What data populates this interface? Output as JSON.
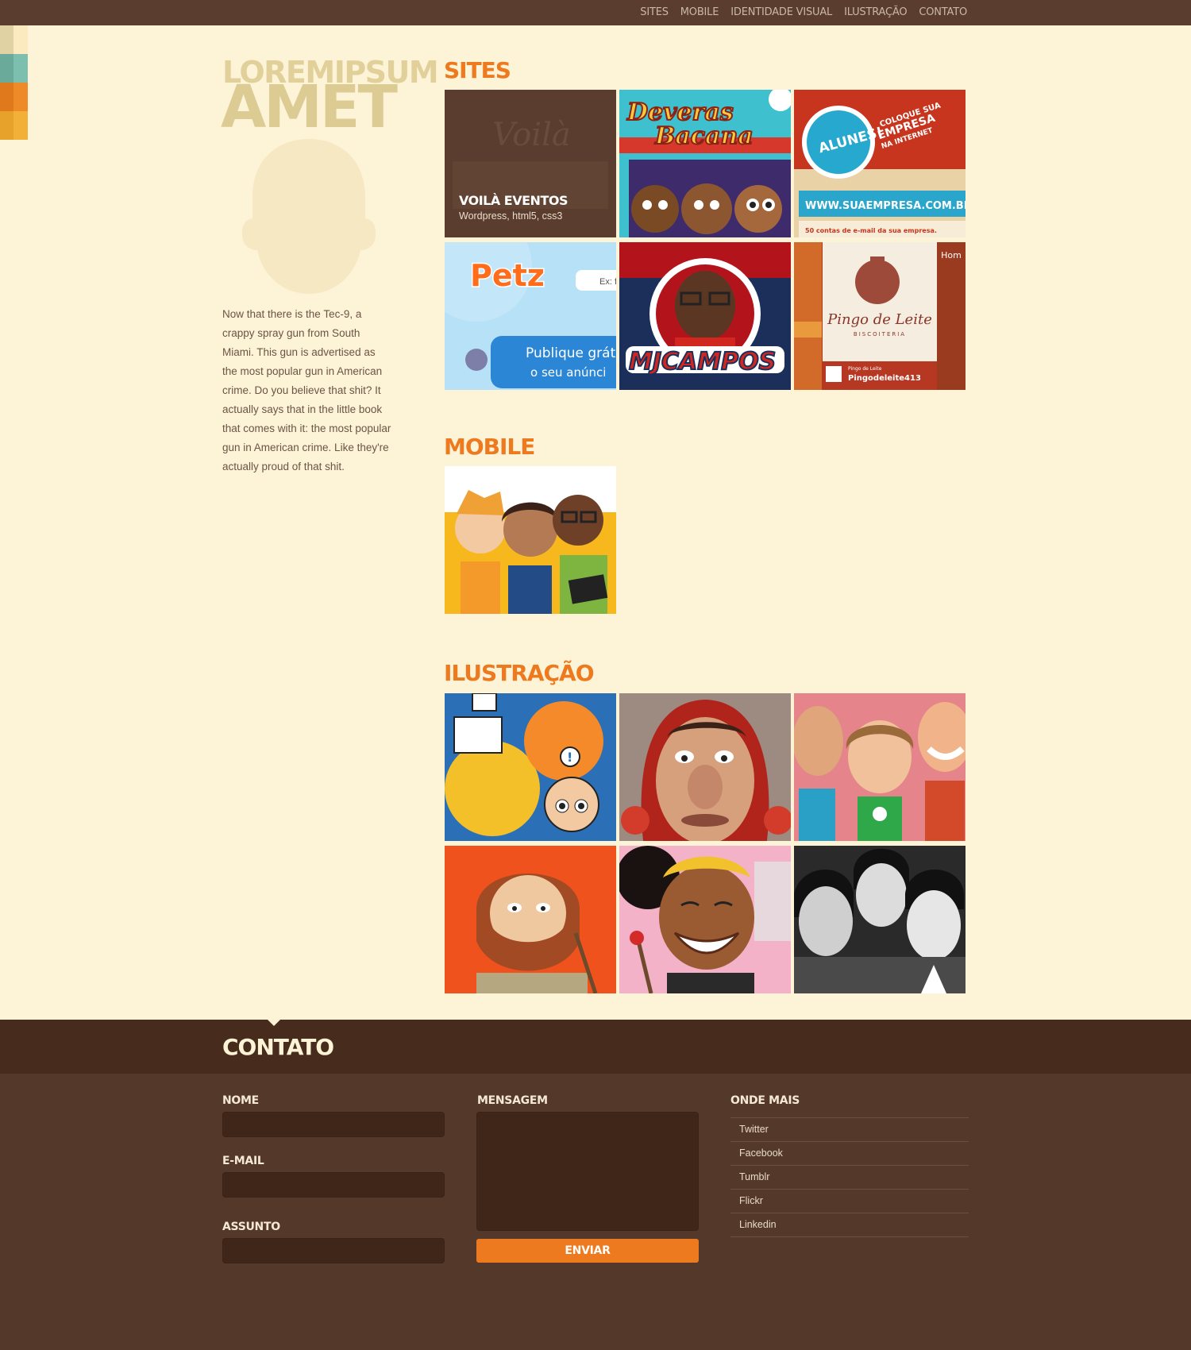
{
  "nav": {
    "items": [
      {
        "label": "SITES"
      },
      {
        "label": "MOBILE"
      },
      {
        "label": "IDENTIDADE VISUAL"
      },
      {
        "label": "ILUSTRAÇÃO"
      },
      {
        "label": "CONTATO"
      }
    ]
  },
  "colors": {
    "topbar": "#5a3d2f",
    "background": "#fdf4d8",
    "accent": "#ee7a1f",
    "swatches": [
      "#e1d2a4",
      "#fbe9bf",
      "#6aaa9b",
      "#7cbfae",
      "#e0791c",
      "#ef8a28",
      "#e6a22b",
      "#f3b038"
    ]
  },
  "profile": {
    "title_small": "LOREMIPSUM",
    "title_big": "AMET",
    "bio": "Now that there is the Tec-9, a crappy spray gun from South Miami. This gun is advertised as the most popular gun in American crime. Do you believe that shit? It actually says that in the little book that comes with it: the most popular gun in American crime. Like they're actually proud of that shit."
  },
  "sites": {
    "title": "SITES",
    "tiles": [
      {
        "kind": "voila",
        "overlay_title": "VOILÀ EVENTOS",
        "overlay_sub": "Wordpress, html5, css3"
      },
      {
        "kind": "deveras",
        "brand1": "Deveras",
        "brand2": "Bacana"
      },
      {
        "kind": "suaempresa",
        "badge": "ALUNES!",
        "promo1": "COLOQUE SUA",
        "promo2": "EMPRESA",
        "promo3": "NA INTERNET",
        "url": "WWW.SUAEMPRESA.COM.BR",
        "note": "50 contas de e-mail da sua empresa."
      },
      {
        "kind": "petz",
        "logo": "Petz",
        "search": "Ex: f",
        "promo1": "Publique grát",
        "promo2": "o seu anúnci"
      },
      {
        "kind": "mjcampos",
        "logo": "MJCAMPOS"
      },
      {
        "kind": "pingo",
        "brand": "Pingo de Leite",
        "sub": "BISCOITERIA",
        "tab": "Hom",
        "handle_small": "Pingo de Leite",
        "handle": "Pingodeleite413"
      }
    ]
  },
  "mobile": {
    "title": "MOBILE",
    "tiles": [
      {
        "kind": "mobile-people"
      }
    ]
  },
  "illustration": {
    "title": "ILUSTRAÇÃO",
    "tiles": [
      {
        "kind": "doodle"
      },
      {
        "kind": "caricature-hood"
      },
      {
        "kind": "caricature-trio"
      },
      {
        "kind": "caricature-beard"
      },
      {
        "kind": "caricature-painter"
      },
      {
        "kind": "caricature-band"
      }
    ]
  },
  "contact": {
    "title": "CONTATO",
    "name_label": "NOME",
    "email_label": "E-MAIL",
    "subject_label": "ASSUNTO",
    "message_label": "MENSAGEM",
    "send_label": "ENVIAR",
    "more_label": "ONDE MAIS",
    "social": [
      {
        "label": "Twitter"
      },
      {
        "label": "Facebook"
      },
      {
        "label": "Tumblr"
      },
      {
        "label": "Flickr"
      },
      {
        "label": "Linkedin"
      }
    ]
  }
}
